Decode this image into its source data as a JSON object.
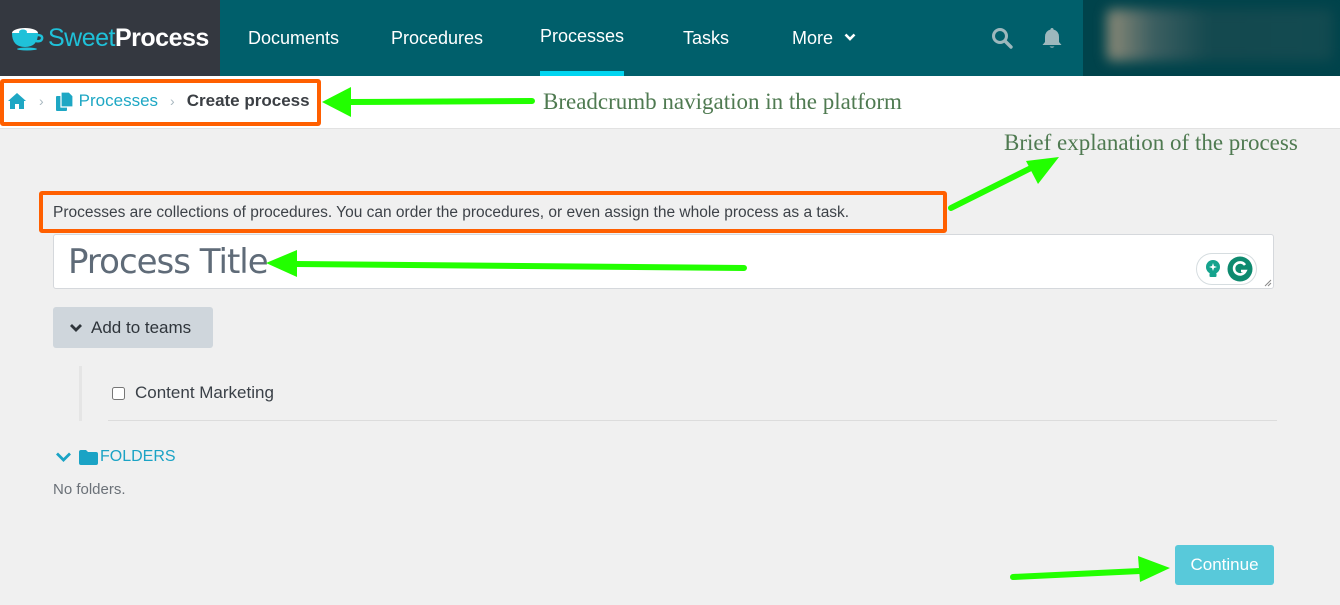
{
  "header": {
    "logo": {
      "light": "Sweet",
      "bold": "Process"
    },
    "nav": [
      {
        "label": "Documents",
        "active": false
      },
      {
        "label": "Procedures",
        "active": false
      },
      {
        "label": "Processes",
        "active": true
      },
      {
        "label": "Tasks",
        "active": false
      },
      {
        "label": "More",
        "active": false,
        "dropdown": true
      }
    ],
    "icons": [
      "search-icon",
      "bell-icon"
    ],
    "user": "blurred-user-profile"
  },
  "breadcrumb": {
    "items": [
      {
        "icon": "home-icon"
      },
      {
        "icon": "copy-icon",
        "label": "Processes"
      },
      {
        "label": "Create process",
        "current": true
      }
    ]
  },
  "annotations": {
    "breadcrumb_note": "Breadcrumb navigation in the platform",
    "explanation_note": "Brief explanation of the process",
    "arrow_color": "#22ff00",
    "box_color": "#ff5f00"
  },
  "form": {
    "intro": "Processes are collections of procedures. You can order the procedures, or even assign the whole process as a task.",
    "title_placeholder": "Process Title",
    "title_value": "",
    "teams_button": "Add to teams",
    "teams": [
      {
        "label": "Content Marketing",
        "checked": false
      }
    ],
    "folders_label": "FOLDERS",
    "no_folders": "No folders.",
    "continue_label": "Continue"
  },
  "colors": {
    "header_bg": "#005f6b",
    "logo_bg": "#343840",
    "accent": "#1ea7c4",
    "active_underline": "#00d5f0",
    "continue_bg": "#58c9da"
  }
}
